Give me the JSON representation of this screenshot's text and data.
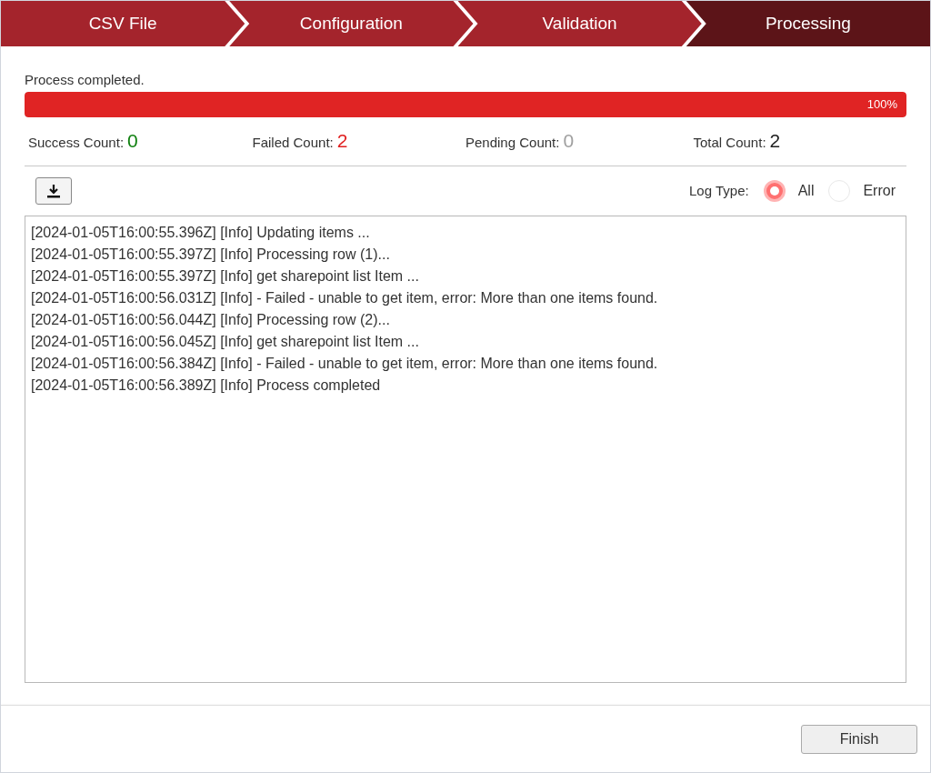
{
  "steps": [
    {
      "label": "CSV File",
      "selected": false
    },
    {
      "label": "Configuration",
      "selected": false
    },
    {
      "label": "Validation",
      "selected": false
    },
    {
      "label": "Processing",
      "selected": true
    }
  ],
  "status": "Process completed.",
  "progress": {
    "level": 1,
    "reading": "100%"
  },
  "counts": [
    {
      "label": "Success Count:",
      "value": "0",
      "color": "#108010"
    },
    {
      "label": "Failed Count:",
      "value": "2",
      "color": "#e02020"
    },
    {
      "label": "Pending Count:",
      "value": "0",
      "color": "#a0a0a0"
    },
    {
      "label": "Total Count:",
      "value": "2",
      "color": "#202020"
    }
  ],
  "log_type": {
    "label": "Log Type:",
    "options": [
      {
        "label": "All",
        "selected": true
      },
      {
        "label": "Error",
        "selected": false
      }
    ]
  },
  "log_lines": [
    "[2024-01-05T16:00:55.396Z] [Info] Updating items ...",
    "[2024-01-05T16:00:55.397Z] [Info] Processing row (1)...",
    "[2024-01-05T16:00:55.397Z] [Info] get sharepoint list Item ...",
    "[2024-01-05T16:00:56.031Z] [Info] - Failed - unable to get item, error: More than one items found.",
    "[2024-01-05T16:00:56.044Z] [Info] Processing row (2)...",
    "[2024-01-05T16:00:56.045Z] [Info] get sharepoint list Item ...",
    "[2024-01-05T16:00:56.384Z] [Info] - Failed - unable to get item, error: More than one items found.",
    "[2024-01-05T16:00:56.389Z] [Info] Process completed"
  ],
  "finish_button": "Finish"
}
